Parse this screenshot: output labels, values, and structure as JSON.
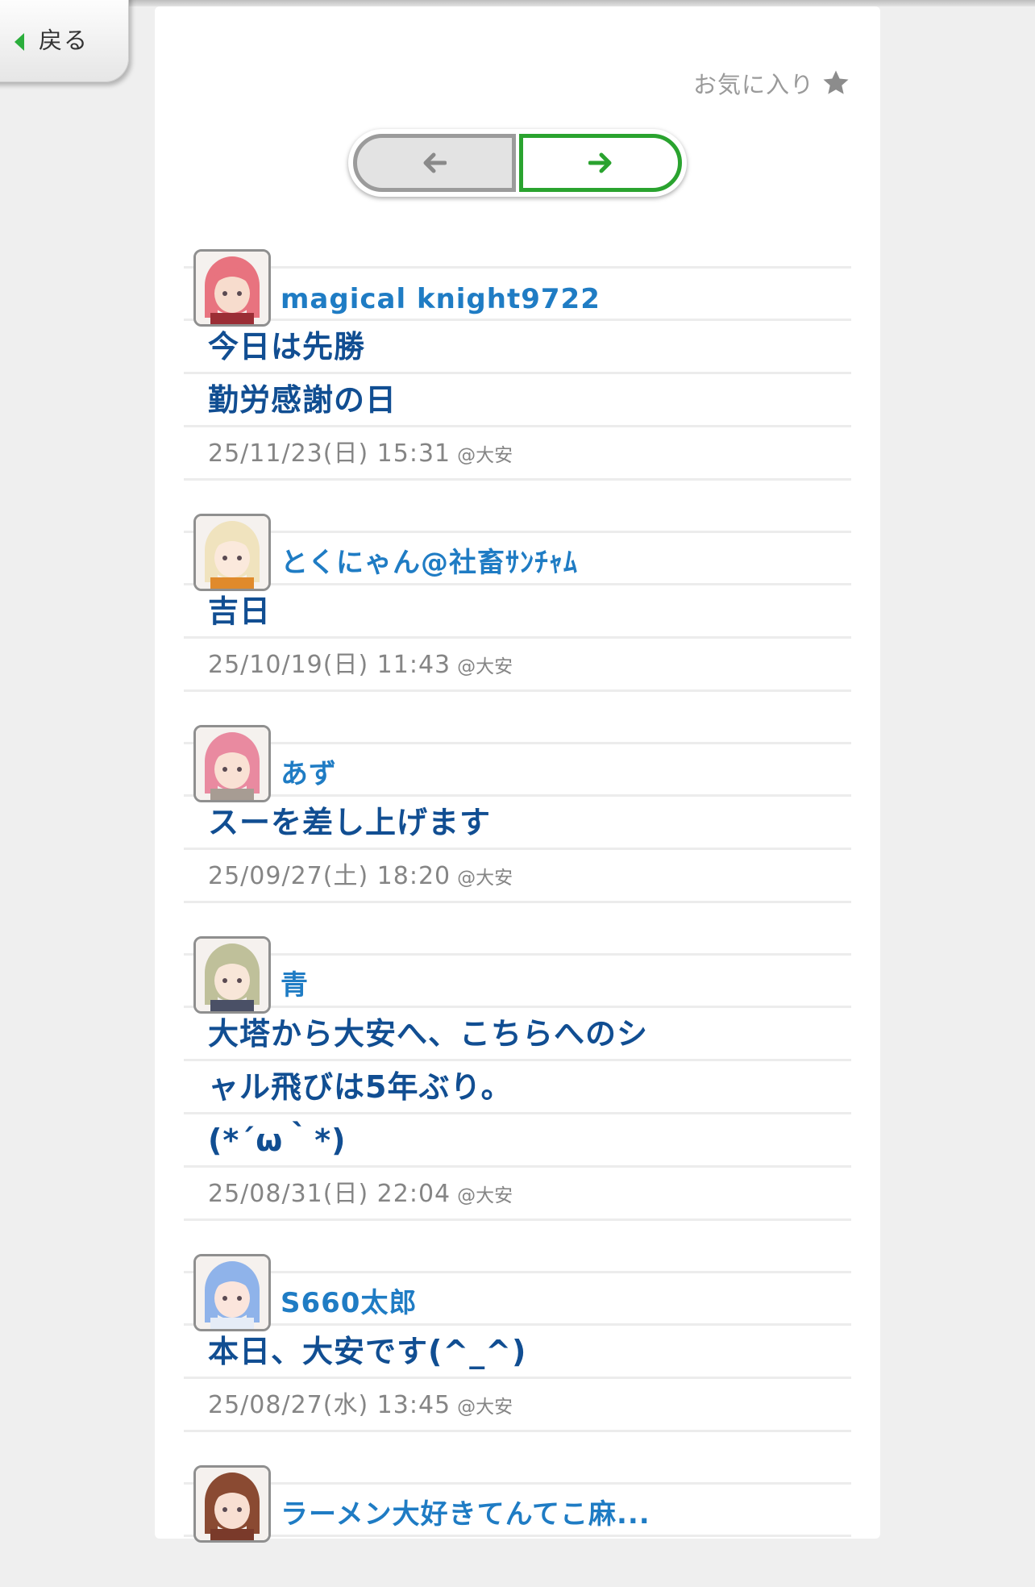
{
  "nav": {
    "back_label": "戻る"
  },
  "favorite": {
    "label": "お気に入り",
    "icon": "star-icon"
  },
  "pager": {
    "prev_icon": "arrow-left-icon",
    "next_icon": "arrow-right-icon"
  },
  "colors": {
    "accent_green": "#2aa32f",
    "username_blue": "#1f7cc4",
    "text_blue": "#114e92"
  },
  "posts": [
    {
      "username": "magical knight9722",
      "avatar_colors": {
        "hair": "#e8737f",
        "skin": "#f7dccd",
        "cloth": "#9b2d35"
      },
      "lines": [
        "今日は先勝",
        "勤労感謝の日"
      ],
      "date": "25/11/23(日) 15:31",
      "location": "@大安"
    },
    {
      "username": "とくにゃん@社畜ｻﾝﾁｬﾑ",
      "avatar_colors": {
        "hair": "#f0e3be",
        "skin": "#fbe9dc",
        "cloth": "#e08a2c"
      },
      "lines": [
        "吉日"
      ],
      "date": "25/10/19(日) 11:43",
      "location": "@大安"
    },
    {
      "username": "あず",
      "avatar_colors": {
        "hair": "#e98aa0",
        "skin": "#f9e1d4",
        "cloth": "#a79c93"
      },
      "lines": [
        "スーを差し上げます"
      ],
      "date": "25/09/27(土) 18:20",
      "location": "@大安"
    },
    {
      "username": "青",
      "avatar_colors": {
        "hair": "#bfc09a",
        "skin": "#f8e6d8",
        "cloth": "#4a5066"
      },
      "lines": [
        "大塔から大安へ、こちらへのシ",
        "ャル飛びは5年ぶり。",
        "(*´ω｀*)"
      ],
      "date": "25/08/31(日) 22:04",
      "location": "@大安"
    },
    {
      "username": "S660太郎",
      "avatar_colors": {
        "hair": "#8fb3ea",
        "skin": "#fbe5dc",
        "cloth": "#e5ecf7"
      },
      "lines": [
        "本日、大安です(^_^)"
      ],
      "date": "25/08/27(水) 13:45",
      "location": "@大安"
    },
    {
      "username": "ラーメン大好きてんてこ麻...",
      "avatar_colors": {
        "hair": "#8a4a32",
        "skin": "#f8dfd2",
        "cloth": "#7a3a2a"
      },
      "lines": [],
      "date": "",
      "location": ""
    }
  ]
}
